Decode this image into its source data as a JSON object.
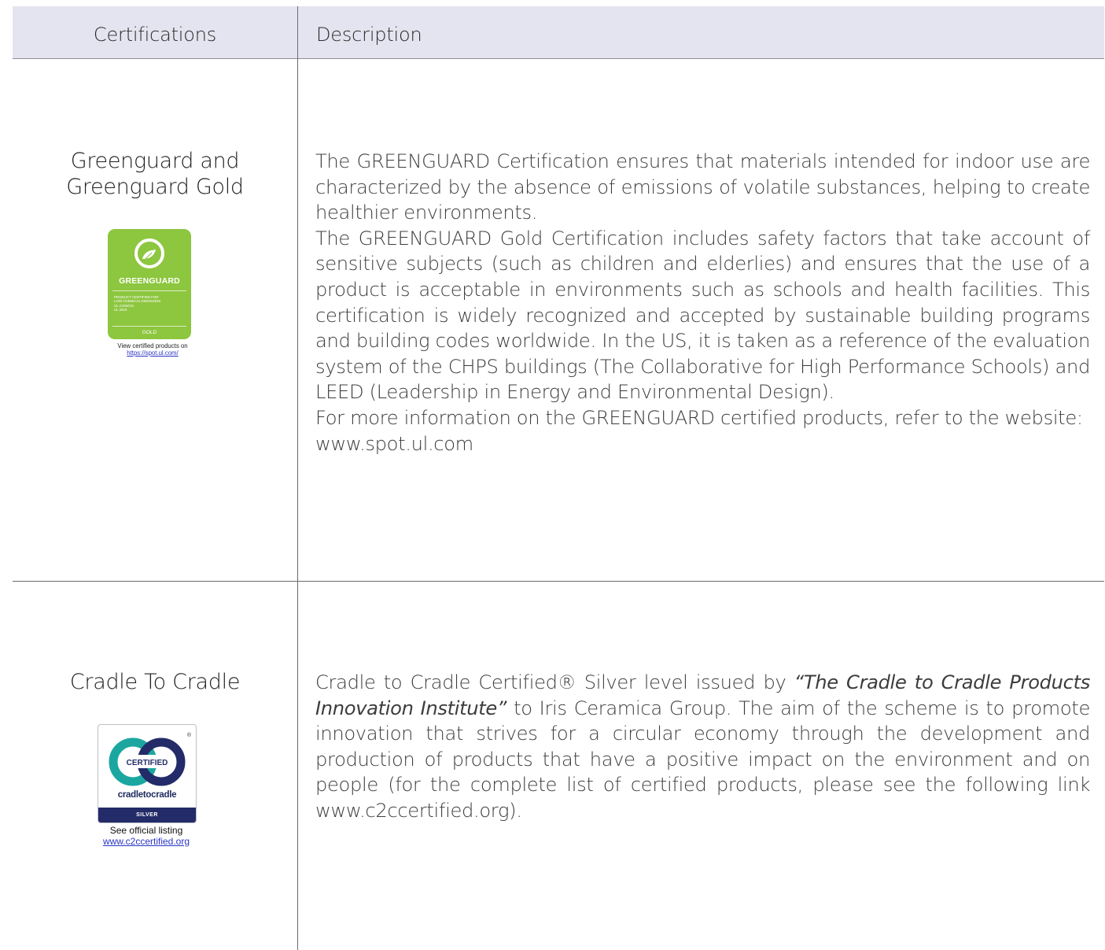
{
  "header": {
    "col1": "Certifications",
    "col2": "Description"
  },
  "rows": [
    {
      "title_line1": "Greenguard and",
      "title_line2": "Greenguard Gold",
      "badge": {
        "icon": "ul-greenguard-logo-icon",
        "ul_mark": "UL",
        "name": "GREENGUARD",
        "small_lines": [
          "PRODUCT CERTIFIED FOR",
          "LOW CHEMICAL EMISSIONS",
          "UL.COM/GG",
          "UL 2818"
        ],
        "level": "GOLD",
        "caption": "View certified products on",
        "link": "https://spot.ul.com/",
        "color": "#8dc63f"
      },
      "paragraphs": [
        "The GREENGUARD Certification ensures that materials intended for indoor use are characterized by the absence of emissions of volatile substances, helping to create healthier environments.",
        "The GREENGUARD Gold Certification includes safety factors that take account of sensitive subjects (such as children and elderlies) and ensures that the use of a product is acceptable in environments such as schools and health facilities. This certification is widely recognized and accepted by sustainable building programs and building codes worldwide. In the US, it is taken as a reference of the evaluation system of the CHPS buildings (The Collaborative for High Performance Schools) and LEED (Leadership in Energy and Environmental Design).",
        "For more information on the GREENGUARD certified products, refer to the website: www.spot.ul.com"
      ]
    },
    {
      "title": "Cradle To Cradle",
      "badge": {
        "icon": "cradle-to-cradle-logo-icon",
        "ring_text": "CERTIFIED",
        "name": "cradletocradle",
        "registered": "®",
        "level": "SILVER",
        "caption": "See official listing",
        "link": "www.c2ccertified.org",
        "color_navy": "#232c68",
        "color_teal": "#1ba7a0"
      },
      "desc_part1": "Cradle to Cradle Certified® Silver level issued by ",
      "desc_italic": "“The Cradle to Cradle Products Innovation Institute”",
      "desc_part2": " to Iris Ceramica Group. The aim of the scheme is to promote innovation that strives for a circular economy through the development and production of products that have a positive impact on the environment and on people (for the complete list of certified products, please see the following link www.c2ccertified.org)."
    }
  ]
}
